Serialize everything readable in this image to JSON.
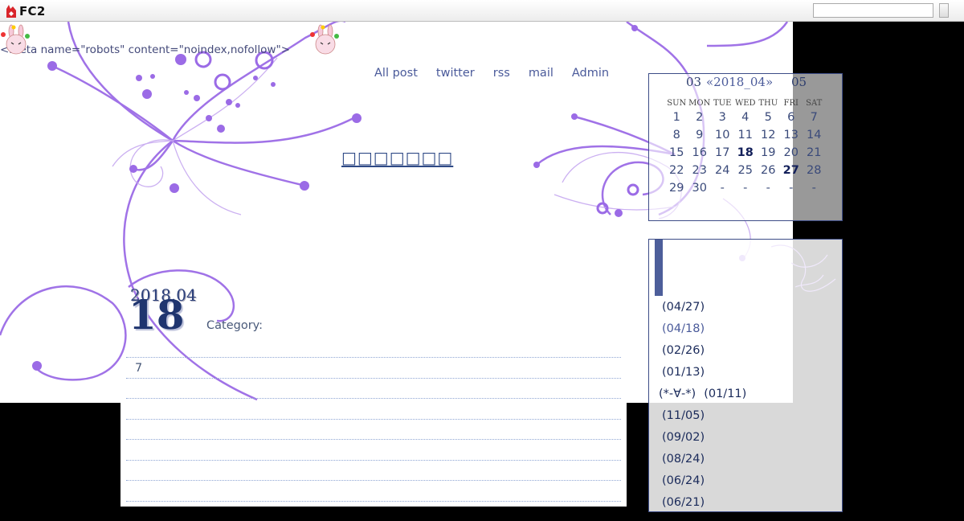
{
  "topbar": {
    "logo_text": "FC2",
    "search_placeholder": ""
  },
  "meta_text": "<meta name=\"robots\" content=\"noindex,nofollow\">",
  "nav": [
    "All post",
    "twitter",
    "rss",
    "mail",
    "Admin"
  ],
  "site_title": "□□□□□□□",
  "post": {
    "year_month": "2018.04",
    "day": "18",
    "category_label": "Category:",
    "body_first_line": "7"
  },
  "calendar": {
    "prev": "03",
    "current": "«2018_04»",
    "next": "05",
    "weekdays": [
      "SUN",
      "MON",
      "TUE",
      "WED",
      "THU",
      "FRI",
      "SAT"
    ],
    "weeks": [
      [
        "1",
        "2",
        "3",
        "4",
        "5",
        "6",
        "7"
      ],
      [
        "8",
        "9",
        "10",
        "11",
        "12",
        "13",
        "14"
      ],
      [
        "15",
        "16",
        "17",
        "18",
        "19",
        "20",
        "21"
      ],
      [
        "22",
        "23",
        "24",
        "25",
        "26",
        "27",
        "28"
      ],
      [
        "29",
        "30",
        "-",
        "-",
        "-",
        "-",
        "-"
      ]
    ],
    "linked_days": [
      "18",
      "27"
    ]
  },
  "sidebar": {
    "entries": [
      {
        "prefix": "",
        "date": "(04/27)",
        "active": false
      },
      {
        "prefix": "",
        "date": "(04/18)",
        "active": true
      },
      {
        "prefix": "",
        "date": "(02/26)",
        "active": false
      },
      {
        "prefix": "",
        "date": "(01/13)",
        "active": false
      },
      {
        "prefix": "(*‐∀‐*)",
        "date": "(01/11)",
        "active": false
      },
      {
        "prefix": "",
        "date": "(11/05)",
        "active": false
      },
      {
        "prefix": "",
        "date": "(09/02)",
        "active": false
      },
      {
        "prefix": "",
        "date": "(08/24)",
        "active": false
      },
      {
        "prefix": "",
        "date": "(06/24)",
        "active": false
      },
      {
        "prefix": "",
        "date": "(06/21)",
        "active": false
      }
    ]
  },
  "colors": {
    "accent": "#4a5a9a",
    "swirl": "#9b6be6",
    "frame": "#3d4d87"
  }
}
